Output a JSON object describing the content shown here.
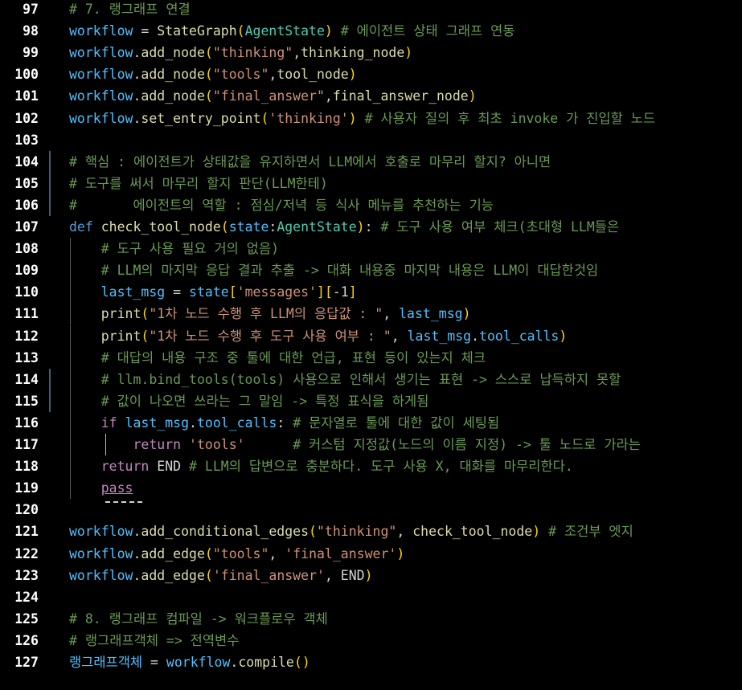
{
  "editor": {
    "lines": [
      {
        "n": "97",
        "tokens": [
          {
            "t": "# 7. 랭그래프 연결",
            "c": "cm"
          }
        ]
      },
      {
        "n": "98",
        "tokens": [
          {
            "t": "workflow",
            "c": "var"
          },
          {
            "t": " = ",
            "c": "op"
          },
          {
            "t": "StateGraph",
            "c": "fn"
          },
          {
            "t": "(",
            "c": "br1"
          },
          {
            "t": "AgentState",
            "c": "cls"
          },
          {
            "t": ")",
            "c": "br1"
          },
          {
            "t": " # 에이전트 상태 그래프 연동",
            "c": "cm"
          }
        ]
      },
      {
        "n": "99",
        "tokens": [
          {
            "t": "workflow",
            "c": "var"
          },
          {
            "t": ".",
            "c": "op"
          },
          {
            "t": "add_node",
            "c": "fn"
          },
          {
            "t": "(",
            "c": "br1"
          },
          {
            "t": "\"thinking\"",
            "c": "str"
          },
          {
            "t": ",",
            "c": "op"
          },
          {
            "t": "thinking_node",
            "c": "fn"
          },
          {
            "t": ")",
            "c": "br1"
          }
        ]
      },
      {
        "n": "100",
        "tokens": [
          {
            "t": "workflow",
            "c": "var"
          },
          {
            "t": ".",
            "c": "op"
          },
          {
            "t": "add_node",
            "c": "fn"
          },
          {
            "t": "(",
            "c": "br1"
          },
          {
            "t": "\"tools\"",
            "c": "str"
          },
          {
            "t": ",",
            "c": "op"
          },
          {
            "t": "tool_node",
            "c": "fn"
          },
          {
            "t": ")",
            "c": "br1"
          }
        ]
      },
      {
        "n": "101",
        "tokens": [
          {
            "t": "workflow",
            "c": "var"
          },
          {
            "t": ".",
            "c": "op"
          },
          {
            "t": "add_node",
            "c": "fn"
          },
          {
            "t": "(",
            "c": "br1"
          },
          {
            "t": "\"final_answer\"",
            "c": "str"
          },
          {
            "t": ",",
            "c": "op"
          },
          {
            "t": "final_answer_node",
            "c": "fn"
          },
          {
            "t": ")",
            "c": "br1"
          }
        ]
      },
      {
        "n": "102",
        "tokens": [
          {
            "t": "workflow",
            "c": "var"
          },
          {
            "t": ".",
            "c": "op"
          },
          {
            "t": "set_entry_point",
            "c": "fn"
          },
          {
            "t": "(",
            "c": "br1"
          },
          {
            "t": "'thinking'",
            "c": "str"
          },
          {
            "t": ")",
            "c": "br1"
          },
          {
            "t": " # 사용자 질의 후 최초 invoke 가 진입할 노드",
            "c": "cm"
          }
        ]
      },
      {
        "n": "103",
        "tokens": []
      },
      {
        "n": "104",
        "tokens": [
          {
            "t": "# 핵심 : 에이전트가 상태값을 유지하면서 LLM에서 호출로 마무리 할지? 아니면",
            "c": "cm"
          }
        ]
      },
      {
        "n": "105",
        "tokens": [
          {
            "t": "# 도구를 써서 마무리 할지 판단(LLM한테)",
            "c": "cm"
          }
        ]
      },
      {
        "n": "106",
        "tokens": [
          {
            "t": "#       에이전트의 역할 : 점심/저녁 등 식사 메뉴를 추천하는 기능",
            "c": "cm"
          }
        ]
      },
      {
        "n": "107",
        "tokens": [
          {
            "t": "def",
            "c": "kw"
          },
          {
            "t": " ",
            "c": "op"
          },
          {
            "t": "check_tool_node",
            "c": "fn"
          },
          {
            "t": "(",
            "c": "br1"
          },
          {
            "t": "state",
            "c": "var"
          },
          {
            "t": ":",
            "c": "op"
          },
          {
            "t": "AgentState",
            "c": "cls"
          },
          {
            "t": ")",
            "c": "br1"
          },
          {
            "t": ": ",
            "c": "op"
          },
          {
            "t": "# 도구 사용 여부 체크(초대형 LLM들은",
            "c": "cm"
          }
        ]
      },
      {
        "n": "108",
        "tokens": [
          {
            "t": "    ",
            "c": "op"
          },
          {
            "t": "# 도구 사용 필요 거의 없음)",
            "c": "cm"
          }
        ]
      },
      {
        "n": "109",
        "tokens": [
          {
            "t": "    ",
            "c": "op"
          },
          {
            "t": "# LLM의 마지막 응답 결과 추출 -> 대화 내용중 마지막 내용은 LLM이 대답한것임",
            "c": "cm"
          }
        ]
      },
      {
        "n": "110",
        "tokens": [
          {
            "t": "    ",
            "c": "op"
          },
          {
            "t": "last_msg",
            "c": "var"
          },
          {
            "t": " = ",
            "c": "op"
          },
          {
            "t": "state",
            "c": "var"
          },
          {
            "t": "[",
            "c": "br1"
          },
          {
            "t": "'messages'",
            "c": "str"
          },
          {
            "t": "]",
            "c": "br1"
          },
          {
            "t": "[",
            "c": "br1"
          },
          {
            "t": "-1",
            "c": "op"
          },
          {
            "t": "]",
            "c": "br1"
          }
        ]
      },
      {
        "n": "111",
        "tokens": [
          {
            "t": "    ",
            "c": "op"
          },
          {
            "t": "print",
            "c": "fn"
          },
          {
            "t": "(",
            "c": "br1"
          },
          {
            "t": "\"1차 노드 수행 후 LLM의 응답값 : \"",
            "c": "str"
          },
          {
            "t": ", ",
            "c": "op"
          },
          {
            "t": "last_msg",
            "c": "var"
          },
          {
            "t": ")",
            "c": "br1"
          }
        ]
      },
      {
        "n": "112",
        "tokens": [
          {
            "t": "    ",
            "c": "op"
          },
          {
            "t": "print",
            "c": "fn"
          },
          {
            "t": "(",
            "c": "br1"
          },
          {
            "t": "\"1차 노드 수행 후 도구 사용 여부 : \"",
            "c": "str"
          },
          {
            "t": ", ",
            "c": "op"
          },
          {
            "t": "last_msg",
            "c": "var"
          },
          {
            "t": ".",
            "c": "op"
          },
          {
            "t": "tool_calls",
            "c": "var"
          },
          {
            "t": ")",
            "c": "br1"
          }
        ]
      },
      {
        "n": "113",
        "tokens": [
          {
            "t": "    ",
            "c": "op"
          },
          {
            "t": "# 대답의 내용 구조 중 툴에 대한 언급, 표현 등이 있는지 체크",
            "c": "cm"
          }
        ]
      },
      {
        "n": "114",
        "tokens": [
          {
            "t": "    ",
            "c": "op"
          },
          {
            "t": "# llm.bind_tools(tools) 사용으로 인해서 생기는 표현 -> 스스로 납득하지 못할",
            "c": "cm"
          }
        ]
      },
      {
        "n": "115",
        "tokens": [
          {
            "t": "    ",
            "c": "op"
          },
          {
            "t": "# 값이 나오면 쓰라는 그 말임 -> 특정 표식을 하게됨",
            "c": "cm"
          }
        ]
      },
      {
        "n": "116",
        "tokens": [
          {
            "t": "    ",
            "c": "op"
          },
          {
            "t": "if",
            "c": "ctl"
          },
          {
            "t": " ",
            "c": "op"
          },
          {
            "t": "last_msg",
            "c": "var"
          },
          {
            "t": ".",
            "c": "op"
          },
          {
            "t": "tool_calls",
            "c": "var"
          },
          {
            "t": ": ",
            "c": "op"
          },
          {
            "t": "# 문자열로 툴에 대한 값이 세팅됨",
            "c": "cm"
          }
        ]
      },
      {
        "n": "117",
        "tokens": [
          {
            "t": "        ",
            "c": "op"
          },
          {
            "t": "return",
            "c": "ctl"
          },
          {
            "t": " ",
            "c": "op"
          },
          {
            "t": "'tools'",
            "c": "str"
          },
          {
            "t": "      ",
            "c": "op"
          },
          {
            "t": "# 커스텀 지정값(노드의 이름 지정) -> 툴 노드로 가라는",
            "c": "cm"
          }
        ]
      },
      {
        "n": "118",
        "tokens": [
          {
            "t": "    ",
            "c": "op"
          },
          {
            "t": "return",
            "c": "ctl"
          },
          {
            "t": " ",
            "c": "op"
          },
          {
            "t": "END",
            "c": "op"
          },
          {
            "t": " # LLM의 답변으로 충분하다. 도구 사용 X, 대화를 마무리한다.",
            "c": "cm"
          }
        ]
      },
      {
        "n": "119",
        "tokens": [
          {
            "t": "    ",
            "c": "op"
          },
          {
            "t": "pass",
            "c": "pass"
          }
        ]
      },
      {
        "n": "120",
        "tokens": []
      },
      {
        "n": "121",
        "tokens": [
          {
            "t": "workflow",
            "c": "var"
          },
          {
            "t": ".",
            "c": "op"
          },
          {
            "t": "add_conditional_edges",
            "c": "fn"
          },
          {
            "t": "(",
            "c": "br1"
          },
          {
            "t": "\"thinking\"",
            "c": "str"
          },
          {
            "t": ", ",
            "c": "op"
          },
          {
            "t": "check_tool_node",
            "c": "fn"
          },
          {
            "t": ")",
            "c": "br1"
          },
          {
            "t": " # 조건부 엣지",
            "c": "cm"
          }
        ]
      },
      {
        "n": "122",
        "tokens": [
          {
            "t": "workflow",
            "c": "var"
          },
          {
            "t": ".",
            "c": "op"
          },
          {
            "t": "add_edge",
            "c": "fn"
          },
          {
            "t": "(",
            "c": "br1"
          },
          {
            "t": "\"tools\"",
            "c": "str"
          },
          {
            "t": ", ",
            "c": "op"
          },
          {
            "t": "'final_answer'",
            "c": "str"
          },
          {
            "t": ")",
            "c": "br1"
          }
        ]
      },
      {
        "n": "123",
        "tokens": [
          {
            "t": "workflow",
            "c": "var"
          },
          {
            "t": ".",
            "c": "op"
          },
          {
            "t": "add_edge",
            "c": "fn"
          },
          {
            "t": "(",
            "c": "br1"
          },
          {
            "t": "'final_answer'",
            "c": "str"
          },
          {
            "t": ", ",
            "c": "op"
          },
          {
            "t": "END",
            "c": "op"
          },
          {
            "t": ")",
            "c": "br1"
          }
        ]
      },
      {
        "n": "124",
        "tokens": []
      },
      {
        "n": "125",
        "tokens": [
          {
            "t": "# 8. 랭그래프 컴파일 -> 워크플로우 객체",
            "c": "cm"
          }
        ]
      },
      {
        "n": "126",
        "tokens": [
          {
            "t": "# 랭그래프객체 => 전역변수",
            "c": "cm"
          }
        ]
      },
      {
        "n": "127",
        "tokens": [
          {
            "t": "랭그래프객체",
            "c": "var"
          },
          {
            "t": " = ",
            "c": "op"
          },
          {
            "t": "workflow",
            "c": "var"
          },
          {
            "t": ".",
            "c": "op"
          },
          {
            "t": "compile",
            "c": "fn"
          },
          {
            "t": "(",
            "c": "br1"
          },
          {
            "t": ")",
            "c": "br1"
          }
        ]
      }
    ],
    "modified_lines": [
      "104",
      "105",
      "106",
      "114",
      "115"
    ],
    "indent_lines": [
      "108",
      "109",
      "110",
      "111",
      "112",
      "113",
      "114",
      "115",
      "116",
      "117",
      "118",
      "119"
    ],
    "nested_indent_lines": [
      "117"
    ],
    "colors": {
      "background": "#000000",
      "comment": "#6a9955",
      "variable": "#4fc1ff",
      "function": "#dcdcaa",
      "string": "#ce9178",
      "keyword": "#569cd6",
      "control": "#c586c0",
      "class": "#4ec9b0",
      "bracket": "#ffd700"
    }
  }
}
